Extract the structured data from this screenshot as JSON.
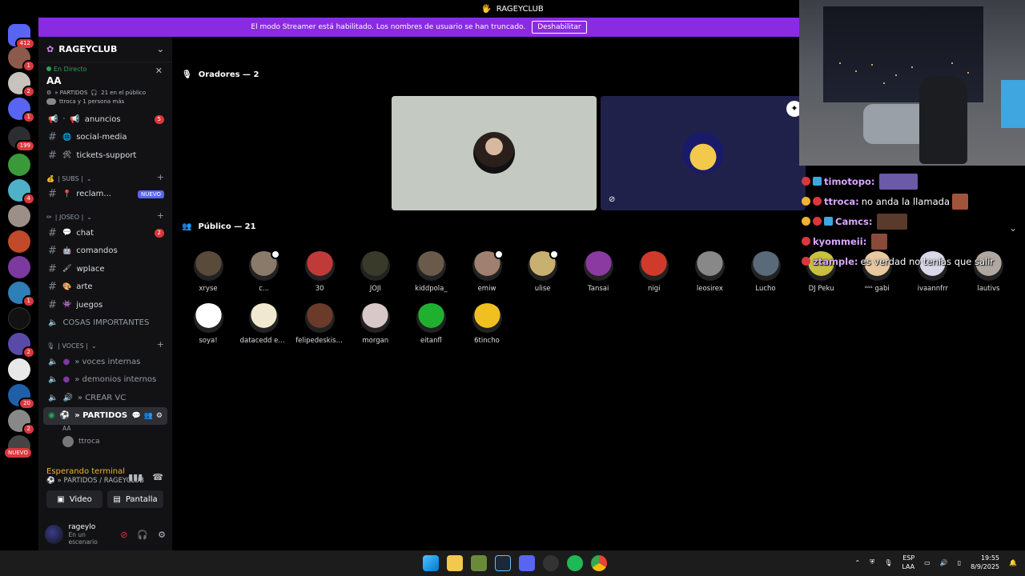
{
  "window": {
    "title": "RAGEYCLUB"
  },
  "banner": {
    "text": "El modo Streamer está habilitado. Los nombres de usuario se han truncado.",
    "button": "Deshabilitar"
  },
  "rail": {
    "badges": [
      "412",
      "1",
      "2",
      "1",
      "199",
      "4",
      "1",
      "2",
      "20",
      "2"
    ],
    "new_label": "NUEVO"
  },
  "server": {
    "name": "RAGEYCLUB"
  },
  "live": {
    "label": "En Directo",
    "title": "AA",
    "channel": "» PARTIDOS",
    "audience": "21 en el público",
    "people": "ttroca y 1 persona más"
  },
  "channels_top": [
    {
      "name": "anuncios",
      "badge": "5"
    },
    {
      "name": "social-media"
    },
    {
      "name": "tickets-support"
    }
  ],
  "cat_subs": "| SUBS |",
  "subs_channels": [
    {
      "name": "reclam...",
      "tag": "NUEVO"
    }
  ],
  "cat_joseo": "| JOSEO |",
  "joseo_channels": [
    {
      "name": "chat",
      "badge": "2"
    },
    {
      "name": "comandos"
    },
    {
      "name": "wplace"
    },
    {
      "name": "arte"
    },
    {
      "name": "juegos"
    }
  ],
  "cosas": "COSAS IMPORTANTES",
  "cat_voces": "| VOCES |",
  "voice_channels": [
    "» voces internas",
    "» demonios internos",
    "» CREAR VC"
  ],
  "active_voice": {
    "name": "» PARTIDOS",
    "sub": "AA",
    "user": "ttroca"
  },
  "vc": {
    "status": "Esperando terminal",
    "path": "» PARTIDOS / RAGEYCLUB",
    "video": "Video",
    "screen": "Pantalla"
  },
  "user": {
    "name": "rageylo",
    "status": "En un escenario"
  },
  "stage": {
    "speakers_title": "Oradores — 2",
    "audience_title": "Público — 21"
  },
  "audience": [
    "xryse",
    "c...",
    "30",
    "JOJI",
    "kiddpola_",
    "emiw",
    "ulise",
    "Tansai",
    "nigi",
    "leosirex",
    "Lucho",
    "DJ Peku",
    "ᵃᵃᵃ gabi",
    "ivaannfrr",
    "lautivs",
    "soya!",
    "datacedd en ig",
    "felipedeskisia...",
    "morgan",
    "eitanfl",
    "6tincho"
  ],
  "chat": [
    {
      "user": "timotopo:",
      "text": ""
    },
    {
      "user": "ttroca:",
      "text": "no anda la llamada"
    },
    {
      "user": "Camcs:",
      "text": ""
    },
    {
      "user": "kyommeii:",
      "text": ""
    },
    {
      "user": "ztample:",
      "text": "es verdad no tenías que salir"
    }
  ],
  "tray": {
    "lang1": "ESP",
    "lang2": "LAA",
    "time": "19:55",
    "date": "8/9/2025"
  },
  "colors": {
    "banner": "#8a2be2",
    "accent": "#5865f2",
    "alert": "#da373c",
    "online": "#23a55a"
  }
}
